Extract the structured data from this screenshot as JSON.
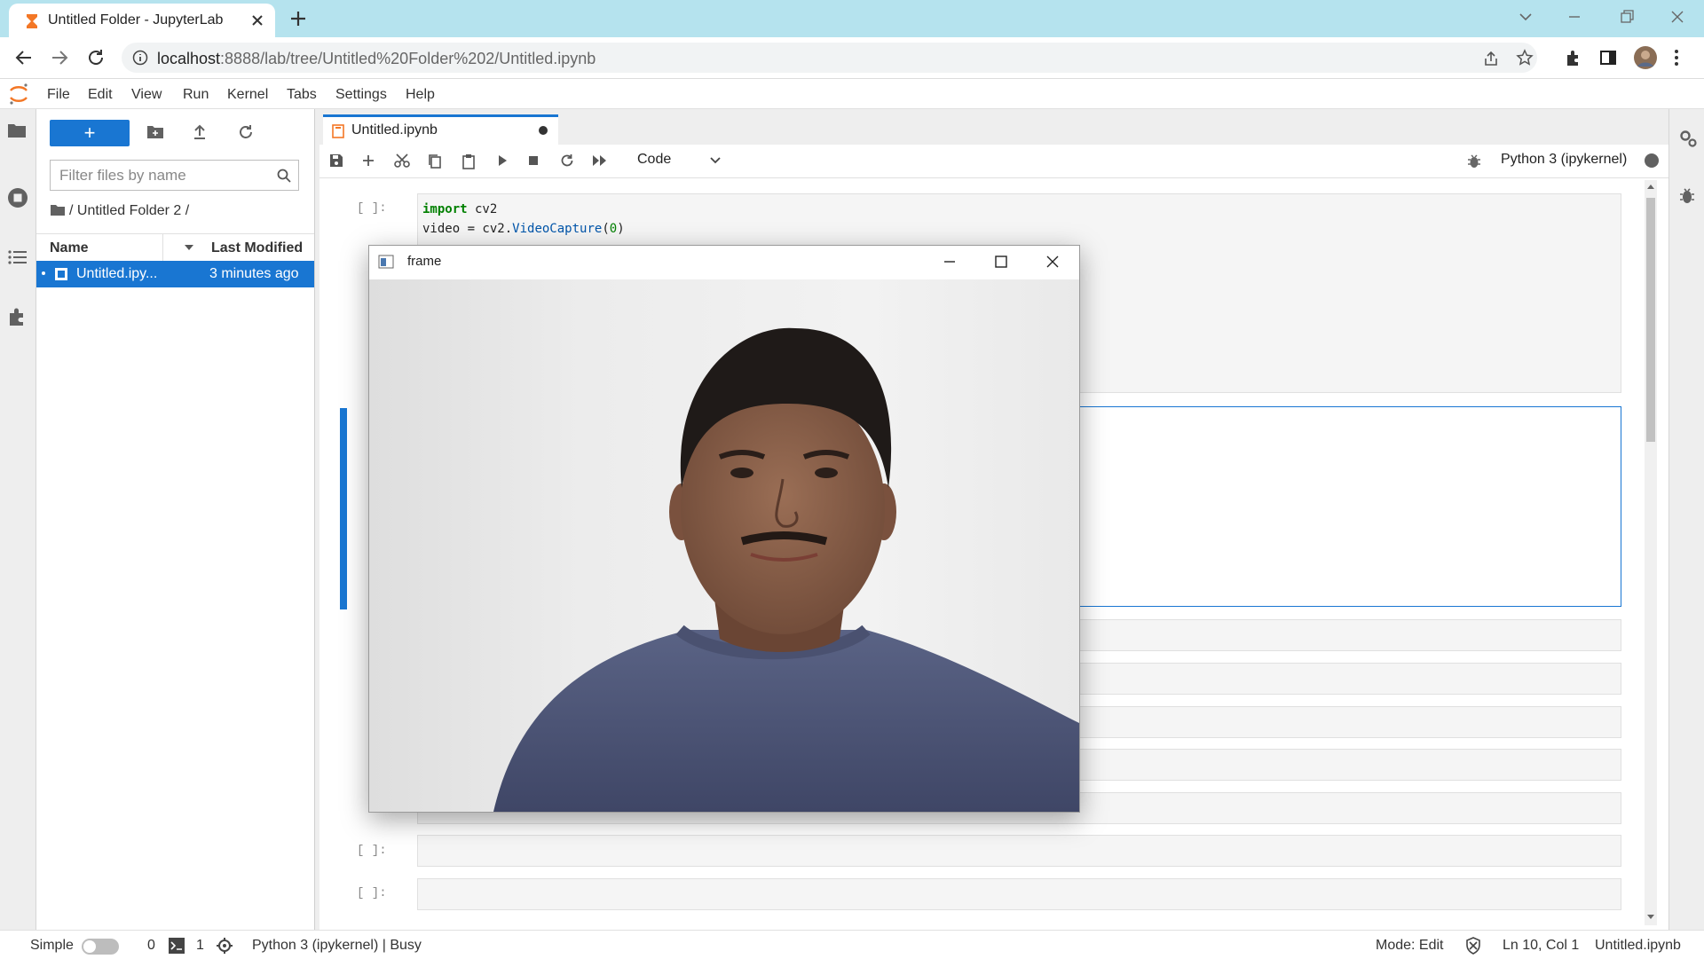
{
  "browser": {
    "tab_title": "Untitled Folder - JupyterLab",
    "url_host": "localhost",
    "url_path": ":8888/lab/tree/Untitled%20Folder%202/Untitled.ipynb"
  },
  "menu": [
    "File",
    "Edit",
    "View",
    "Run",
    "Kernel",
    "Tabs",
    "Settings",
    "Help"
  ],
  "filebrowser": {
    "new_label": "+",
    "filter_placeholder": "Filter files by name",
    "breadcrumb": "/ Untitled Folder 2 /",
    "col_name": "Name",
    "col_modified": "Last Modified",
    "files": [
      {
        "name": "Untitled.ipy...",
        "modified": "3 minutes ago"
      }
    ]
  },
  "notebook": {
    "tab_title": "Untitled.ipynb",
    "cell_type": "Code",
    "kernel": "Python 3 (ipykernel)",
    "prompt": "[ ]:",
    "code": {
      "line1_kw": "import",
      "line1_rest": " cv2",
      "line2_a": "video = cv2.",
      "line2_fn": "VideoCapture",
      "line2_b": "(",
      "line2_num": "0",
      "line2_c": ")"
    }
  },
  "status": {
    "mode_label": "Simple",
    "count_a": "0",
    "count_b": "1",
    "kernel_status": "Python 3 (ipykernel) | Busy",
    "mode": "Mode: Edit",
    "position": "Ln 10, Col 1",
    "file": "Untitled.ipynb"
  },
  "frame_window": {
    "title": "frame"
  },
  "colors": {
    "accent": "#1976d2",
    "title_bar": "#b5e3ee",
    "jupyter_orange": "#f37726"
  }
}
